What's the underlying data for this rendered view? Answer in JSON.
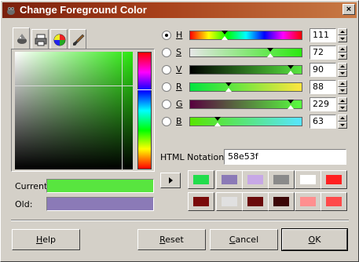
{
  "window": {
    "title": "Change Foreground Color",
    "close_icon": "close-icon"
  },
  "tabs": [
    {
      "name": "tab-gimp-selector",
      "icon": "wilber-icon"
    },
    {
      "name": "tab-cmyk",
      "icon": "printer-icon"
    },
    {
      "name": "tab-watercolor",
      "icon": "color-wheel-icon"
    },
    {
      "name": "tab-scales",
      "icon": "paintbrush-icon"
    }
  ],
  "current_label": "Current:",
  "old_label": "Old:",
  "current_color": "#58e53f",
  "old_color": "#8b7ab7",
  "channels": [
    {
      "label": "H",
      "value": "111",
      "checked": true,
      "level": 0.31,
      "gradient": "linear-gradient(to right,#ff0000,#ffff00,#00ff00,#00ffff,#0000ff,#ff00ff,#ff0000)"
    },
    {
      "label": "S",
      "value": "72",
      "checked": false,
      "level": 0.72,
      "gradient": "linear-gradient(to right,#e6e6e6,#2be80f)"
    },
    {
      "label": "V",
      "value": "90",
      "checked": false,
      "level": 0.9,
      "gradient": "linear-gradient(to right,#000000,#58e53f)"
    },
    {
      "label": "R",
      "value": "88",
      "checked": false,
      "level": 0.345,
      "gradient": "linear-gradient(to right,#00e53f,#ffe53f)"
    },
    {
      "label": "G",
      "value": "229",
      "checked": false,
      "level": 0.898,
      "gradient": "linear-gradient(to right,#58003f,#58ff3f)"
    },
    {
      "label": "B",
      "value": "63",
      "checked": false,
      "level": 0.247,
      "gradient": "linear-gradient(to right,#58e500,#58e5ff)"
    }
  ],
  "html_notation_label": "HTML Notation:",
  "html_notation_value": "58e53f",
  "history_colors": [
    [
      "#22dd4d",
      "#8b7ab7",
      "#c7a8e6",
      "#8a8a8a",
      "#ffffff",
      "#ff2020"
    ],
    [
      "#7a0a0a",
      "#e0e0e0",
      "#6a0a0a",
      "#3c0707",
      "#ff8f8f",
      "#ff4a4a"
    ]
  ],
  "buttons": {
    "help": {
      "mnemonic": "H",
      "rest": "elp"
    },
    "reset": {
      "mnemonic": "R",
      "rest": "eset"
    },
    "cancel": {
      "mnemonic": "C",
      "rest": "ancel"
    },
    "ok": {
      "mnemonic": "O",
      "rest": "K"
    }
  }
}
